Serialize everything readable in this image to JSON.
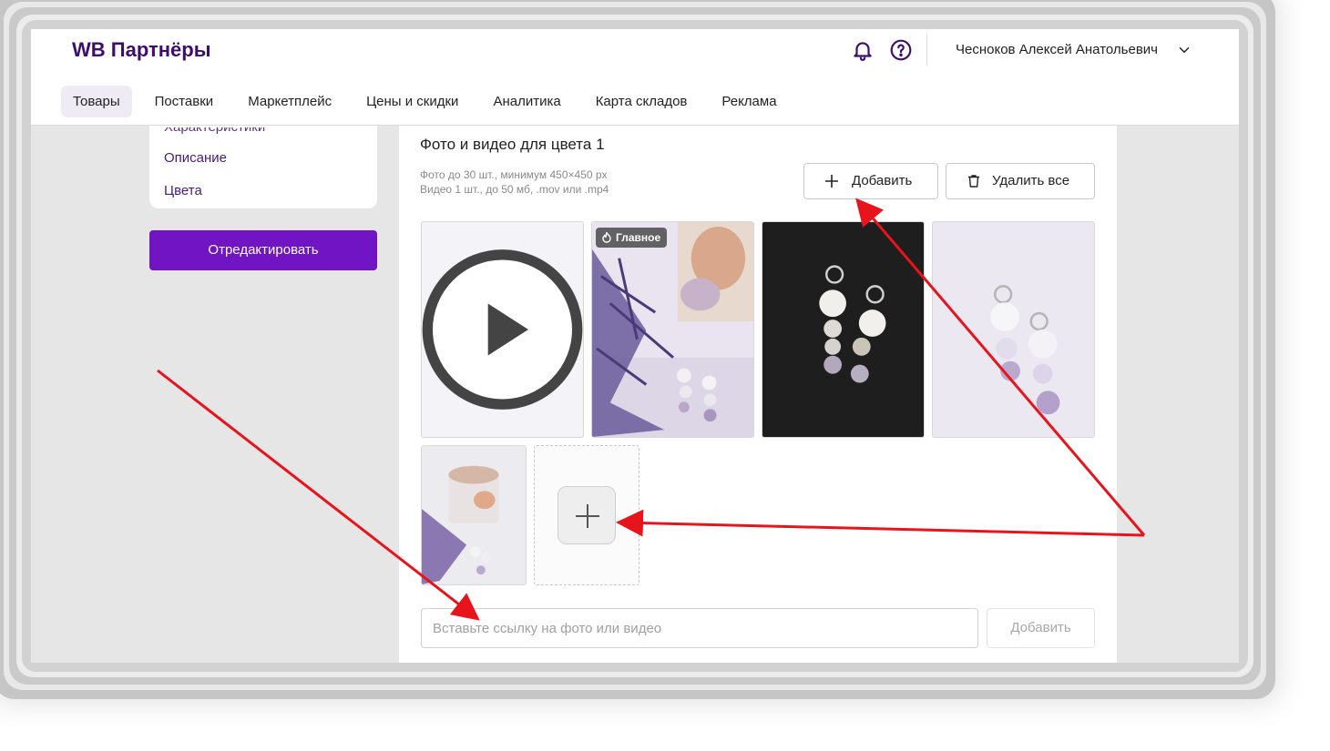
{
  "header": {
    "logo": "WB Партнёры",
    "user_name": "Чесноков Алексей Анатольевич",
    "icons": [
      "bell-icon",
      "help-icon",
      "chevron-down-icon"
    ]
  },
  "nav": {
    "items": [
      {
        "label": "Товары",
        "active": true
      },
      {
        "label": "Поставки",
        "active": false
      },
      {
        "label": "Маркетплейс",
        "active": false
      },
      {
        "label": "Цены и скидки",
        "active": false
      },
      {
        "label": "Аналитика",
        "active": false
      },
      {
        "label": "Карта складов",
        "active": false
      },
      {
        "label": "Реклама",
        "active": false
      }
    ]
  },
  "sidebar": {
    "links": [
      "Характеристики",
      "Описание",
      "Цвета"
    ],
    "edit_button": "Отредактировать"
  },
  "media": {
    "title": "Фото и видео для цвета 1",
    "hint_photo": "Фото до 30 шт., минимум 450×450 px",
    "hint_video": "Видео 1 шт., до 50 мб, .mov или .mp4",
    "add_button": "Добавить",
    "delete_all_button": "Удалить все",
    "main_badge": "Главное",
    "url_placeholder": "Вставьте ссылку на фото или видео",
    "url_add_button": "Добавить"
  },
  "colors": {
    "brand": "#3d0e6b",
    "accent": "#7014c4",
    "annotation_arrow": "#e8141b"
  }
}
